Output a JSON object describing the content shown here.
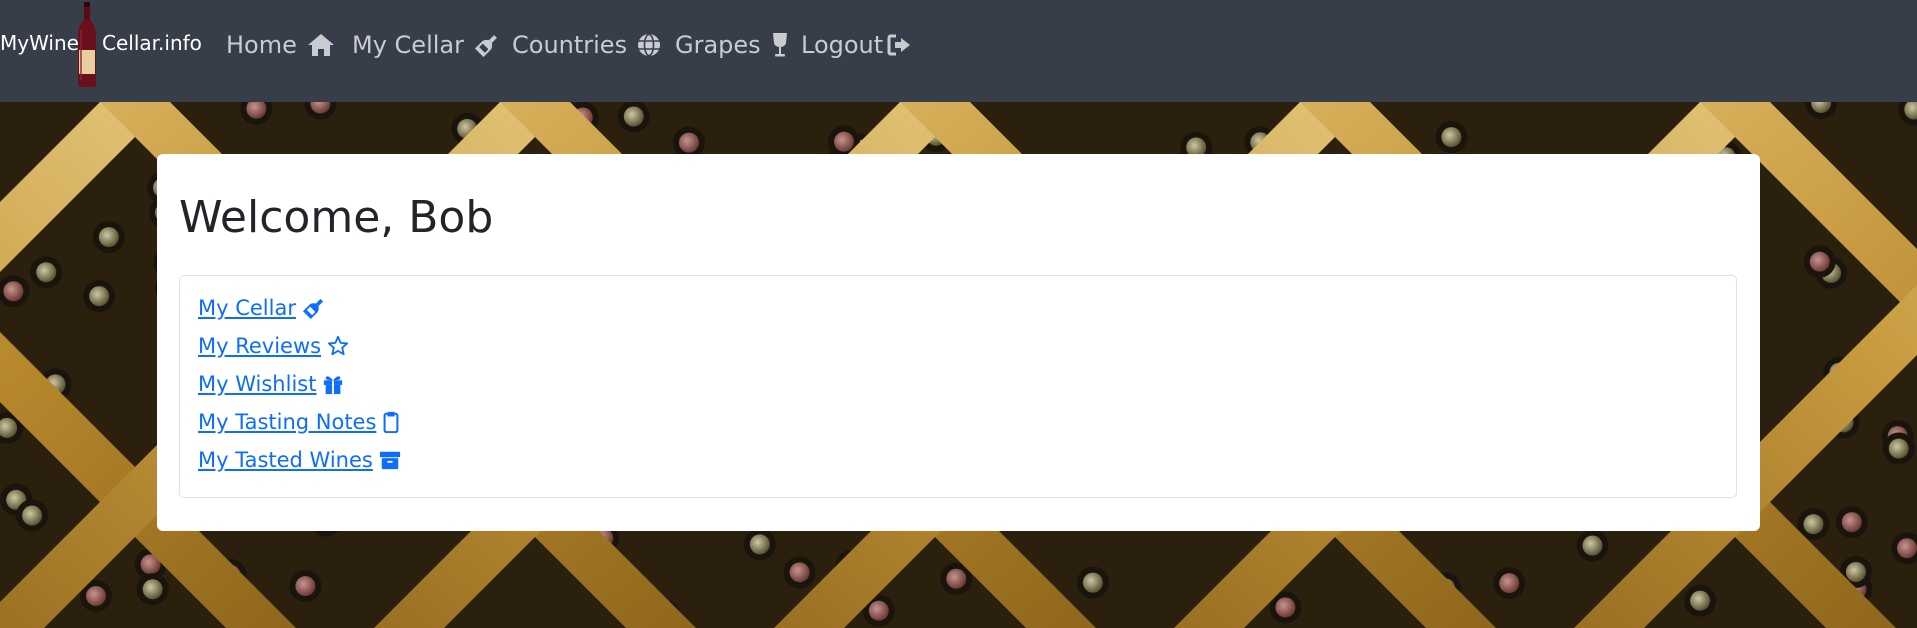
{
  "brand": {
    "part1": "MyWine",
    "part2": "Cellar.info"
  },
  "nav": {
    "home": "Home",
    "cellar": "My Cellar",
    "countries": "Countries",
    "grapes": "Grapes",
    "logout": "Logout"
  },
  "main": {
    "welcome": "Welcome, Bob",
    "links": [
      {
        "label": "My Cellar",
        "icon": "bottle-icon"
      },
      {
        "label": "My Reviews",
        "icon": "star-icon"
      },
      {
        "label": "My Wishlist",
        "icon": "gift-icon"
      },
      {
        "label": "My Tasting Notes",
        "icon": "clipboard-icon"
      },
      {
        "label": "My Tasted Wines",
        "icon": "archive-icon"
      }
    ]
  },
  "colors": {
    "navbar": "#383d4a",
    "link": "#0d6efd",
    "rack_wood": "#b8892e"
  }
}
